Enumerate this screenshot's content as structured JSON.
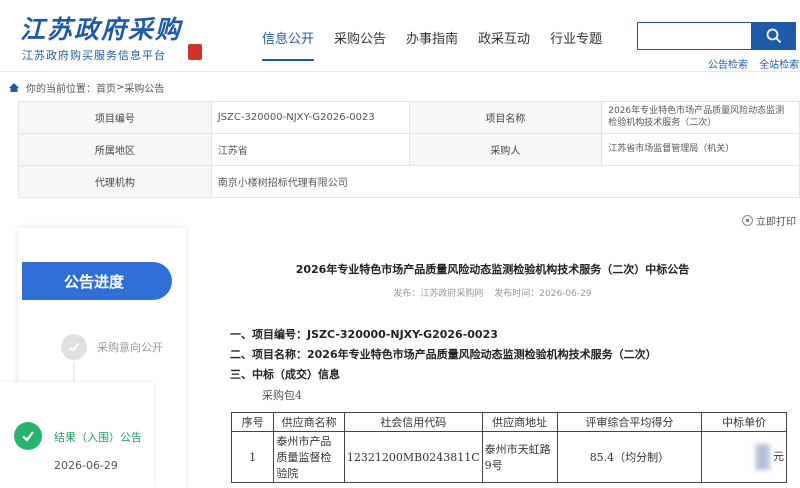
{
  "header": {
    "logo_title": "江苏政府采购",
    "logo_subtitle": "江苏政府购买服务信息平台",
    "nav": [
      "信息公开",
      "采购公告",
      "办事指南",
      "政采互动",
      "行业专题"
    ],
    "search": {
      "placeholder": "",
      "links": [
        "公告检索",
        "全站检索"
      ]
    }
  },
  "breadcrumb": {
    "prefix": "你的当前位置：",
    "home": "首页",
    "sep": " > ",
    "current": "采购公告"
  },
  "info": {
    "label_project_no": "项目编号",
    "project_no": "JSZC-320000-NJXY-G2026-0023",
    "label_project_name": "项目名称",
    "project_name": "2026年专业特色市场产品质量风险动态监测检验机构技术服务（二次）",
    "label_region": "所属地区",
    "region": "江苏省",
    "label_purchaser": "采购人",
    "purchaser": "江苏省市场监督管理局（机关）",
    "label_agency": "代理机构",
    "agency": "南京小楼树招标代理有限公司"
  },
  "print_label": "立即打印",
  "sidebar": {
    "progress_label": "公告进度",
    "step1": "采购意向公开",
    "step2": "结果（入围）公告",
    "step2_date": "2026-06-29"
  },
  "article": {
    "title": "2026年专业特色市场产品质量风险动态监测检验机构技术服务（二次）中标公告",
    "publisher": "发布：江苏政府采购网",
    "time": "发布时间：2026-06-29",
    "s1": "一、项目编号：JSZC-320000-NJXY-G2026-0023",
    "s2": "二、项目名称：2026年专业特色市场产品质量风险动态监测检验机构技术服务（二次）",
    "s3": "三、中标（成交）信息",
    "package": "采购包4",
    "table": {
      "headers": [
        "序号",
        "供应商名称",
        "社会信用代码",
        "供应商地址",
        "评审综合平均得分",
        "中标单价"
      ],
      "row": {
        "no": "1",
        "name": "泰州市产品质量监督检验院",
        "code": "12321200MB0243811C",
        "address": "泰州市天虹路9号",
        "score": "85.4（均分制）",
        "price_unit": "元"
      }
    }
  },
  "colors": {
    "brand": "#1f5aa8",
    "progress": "#2f6fd6",
    "done": "#27b36b"
  }
}
